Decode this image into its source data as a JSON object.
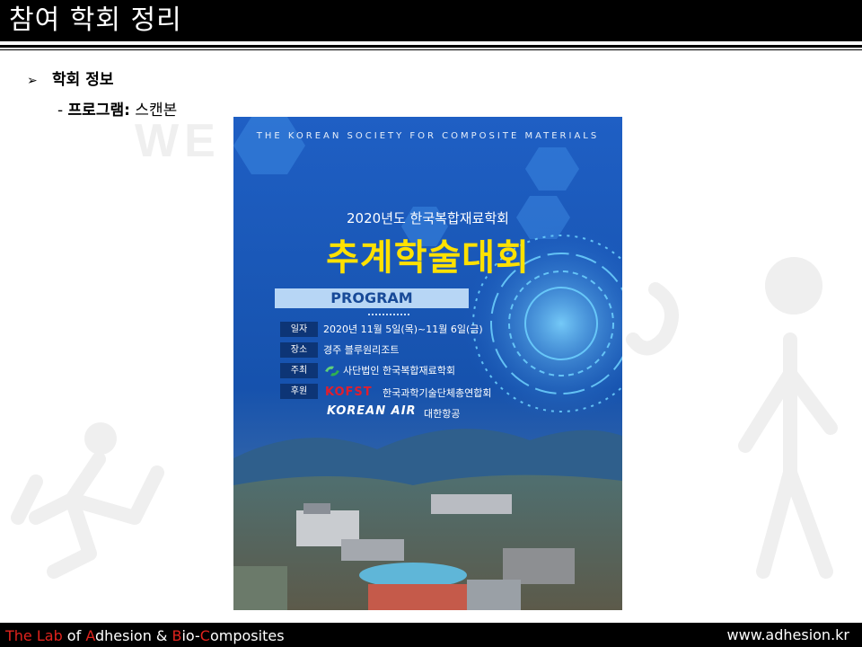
{
  "header": {
    "title": "참여 학회 정리"
  },
  "background_watermark": {
    "text": "WE ... TAL."
  },
  "content": {
    "bullet": {
      "arrow": "➢",
      "label": "학회 정보"
    },
    "sub": {
      "prefix": "- ",
      "label": "프로그램:",
      "value": " 스캔본"
    }
  },
  "poster": {
    "society": "THE KOREAN SOCIETY FOR COMPOSITE MATERIALS",
    "year_line": "2020년도 한국복합재료학회",
    "title": "추계학술대회",
    "program": "PROGRAM",
    "info": [
      {
        "tag": "일자",
        "value": "2020년 11월 5일(목)~11월 6일(금)"
      },
      {
        "tag": "장소",
        "value": "경주 블루원리조트"
      },
      {
        "tag": "주최",
        "value": "사단법인 한국복합재료학회"
      },
      {
        "tag": "후원",
        "value": ""
      }
    ],
    "sponsors": {
      "kofst_logo": "KOFST",
      "kofst_name": "한국과학기술단체총연합회",
      "korean_air_logo": "KOREAN AIR",
      "korean_air_name": "대한항공"
    }
  },
  "footer": {
    "lab": {
      "p1": "The Lab",
      "p2": " of ",
      "p3": "A",
      "p4": "dhesion",
      "p5": " & ",
      "p6": "B",
      "p7": "io-",
      "p8": "C",
      "p9": "omposites"
    },
    "url": "www.adhesion.kr"
  },
  "colors": {
    "header_bg": "#000000",
    "poster_blue": "#1859b8",
    "title_yellow": "#ffe100",
    "footer_accent_red": "#e1231d"
  }
}
